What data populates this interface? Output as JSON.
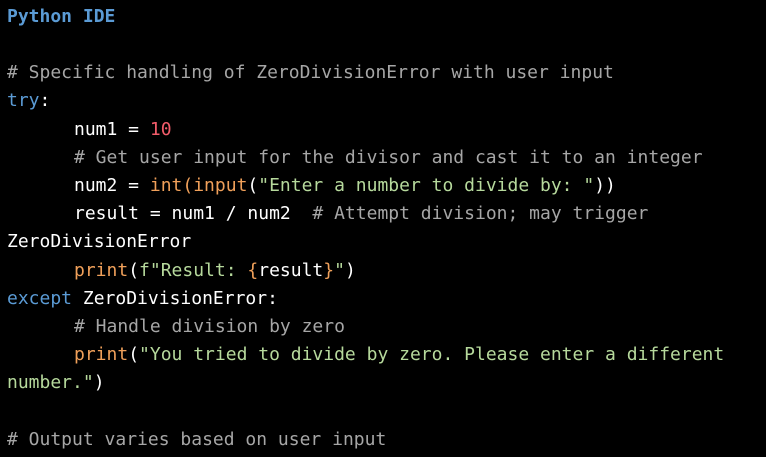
{
  "app": {
    "title": "Python IDE"
  },
  "code": {
    "comment_header": "# Specific handling of ZeroDivisionError with user input",
    "kw_try": "try",
    "colon": ":",
    "num1_lhs": "num1 = ",
    "num1_val": "10",
    "comment_input": "# Get user input for the divisor and cast it to an integer",
    "num2_lhs": "num2 = ",
    "fn_int": "int",
    "paren_open": "(",
    "fn_input": "input",
    "str_prompt": "\"Enter a number to divide by: \"",
    "parens_close_two": "))",
    "result_stmt": "result = num1 / num2  ",
    "comment_attempt": "# Attempt division; may trigger",
    "wrap_error": "ZeroDivisionError",
    "fn_print": "print",
    "fstr_start": "f\"Result: ",
    "fstr_brace_open": "{",
    "fstr_var": "result",
    "fstr_brace_close": "}",
    "fstr_end": "\"",
    "paren_close": ")",
    "kw_except": "except",
    "except_type": " ZeroDivisionError:",
    "comment_handle": "# Handle division by zero",
    "str_msg_part1": "\"You tried to divide by zero. Please enter a different",
    "str_msg_part2": "number.\"",
    "comment_output": "# Output varies based on user input"
  },
  "colors": {
    "background": "#000000",
    "keyword": "#5b9bd5",
    "number": "#f25c6a",
    "comment": "#a6a6a6",
    "string": "#b6d99c",
    "builtin": "#f0a05a"
  }
}
